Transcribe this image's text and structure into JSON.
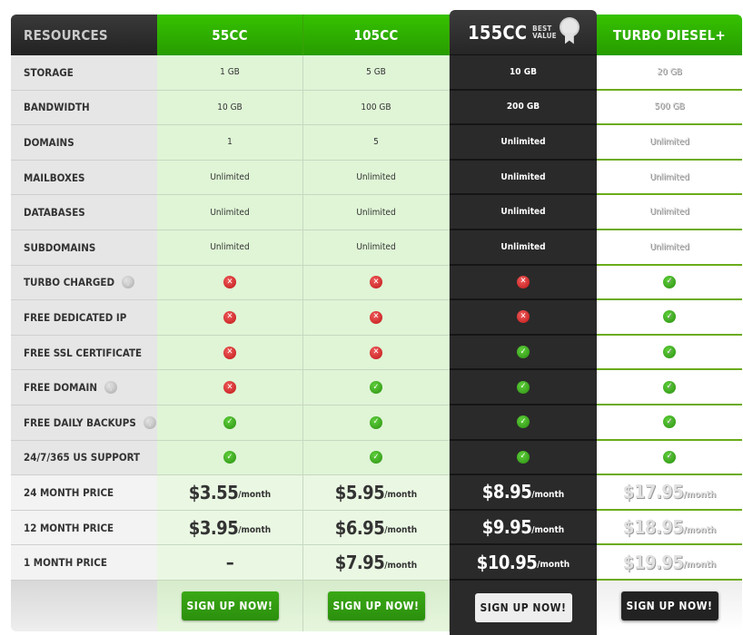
{
  "header": {
    "label": "RESOURCES",
    "plans": [
      "55CC",
      "105CC",
      "155CC",
      "TURBO DIESEL+"
    ],
    "badge_line1": "BEST",
    "badge_line2": "VALUE"
  },
  "rows": [
    {
      "label": "STORAGE",
      "values": [
        "1 GB",
        "5 GB",
        "10 GB",
        "20 GB"
      ]
    },
    {
      "label": "BANDWIDTH",
      "values": [
        "10 GB",
        "100 GB",
        "200 GB",
        "500 GB"
      ]
    },
    {
      "label": "DOMAINS",
      "values": [
        "1",
        "5",
        "Unlimited",
        "Unlimited"
      ]
    },
    {
      "label": "MAILBOXES",
      "values": [
        "Unlimited",
        "Unlimited",
        "Unlimited",
        "Unlimited"
      ]
    },
    {
      "label": "DATABASES",
      "values": [
        "Unlimited",
        "Unlimited",
        "Unlimited",
        "Unlimited"
      ]
    },
    {
      "label": "SUBDOMAINS",
      "values": [
        "Unlimited",
        "Unlimited",
        "Unlimited",
        "Unlimited"
      ]
    },
    {
      "label": "TURBO CHARGED",
      "info": true,
      "flags": [
        false,
        false,
        false,
        true
      ]
    },
    {
      "label": "FREE DEDICATED IP",
      "flags": [
        false,
        false,
        false,
        true
      ]
    },
    {
      "label": "FREE SSL CERTIFICATE",
      "flags": [
        false,
        false,
        true,
        true
      ]
    },
    {
      "label": "FREE DOMAIN",
      "info": true,
      "flags": [
        false,
        true,
        true,
        true
      ]
    },
    {
      "label": "FREE DAILY BACKUPS",
      "info": true,
      "flags": [
        true,
        true,
        true,
        true
      ]
    },
    {
      "label": "24/7/365 US SUPPORT",
      "flags": [
        true,
        true,
        true,
        true
      ]
    }
  ],
  "prices": [
    {
      "label": "24 MONTH PRICE",
      "values": [
        "$3.55",
        "$5.95",
        "$8.95",
        "$17.95"
      ]
    },
    {
      "label": "12 MONTH PRICE",
      "values": [
        "$3.95",
        "$6.95",
        "$9.95",
        "$18.95"
      ]
    },
    {
      "label": "1 MONTH PRICE",
      "values": [
        "–",
        "$7.95",
        "$10.95",
        "$19.95"
      ]
    }
  ],
  "price_unit": "/month",
  "signup_label": "SIGN UP NOW!",
  "icons": {
    "yes": "check-icon",
    "no": "x-icon",
    "info": "info-icon"
  },
  "colors": {
    "green": "#2f9f0a",
    "dark": "#2a2a2a",
    "light_green": "#dff5d6",
    "turbo_line": "#6bab1b"
  }
}
